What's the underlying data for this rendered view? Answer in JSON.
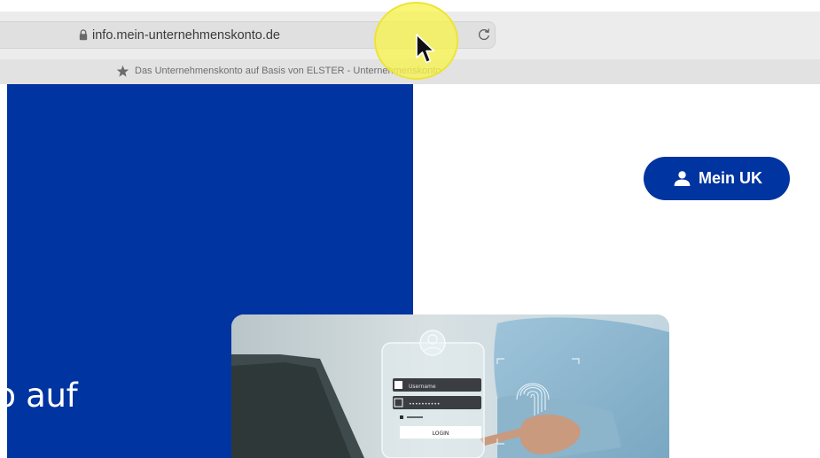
{
  "browser": {
    "url": "info.mein-unternehmenskonto.de",
    "tab_title": "Das Unternehmenskonto auf Basis von ELSTER - Unternehmenskonto",
    "icons": {
      "lock": "lock-icon",
      "reload": "reload-icon",
      "tab": "star-icon"
    }
  },
  "page": {
    "hero_heading": "nto auf",
    "mein_uk_button": {
      "label": "Mein UK",
      "icon": "user-icon"
    },
    "hero_image": {
      "username_placeholder": "Username",
      "login_button": "LOGIN"
    },
    "colors": {
      "brand_blue": "#0034a0",
      "cursor_highlight": "#f7f350"
    }
  }
}
